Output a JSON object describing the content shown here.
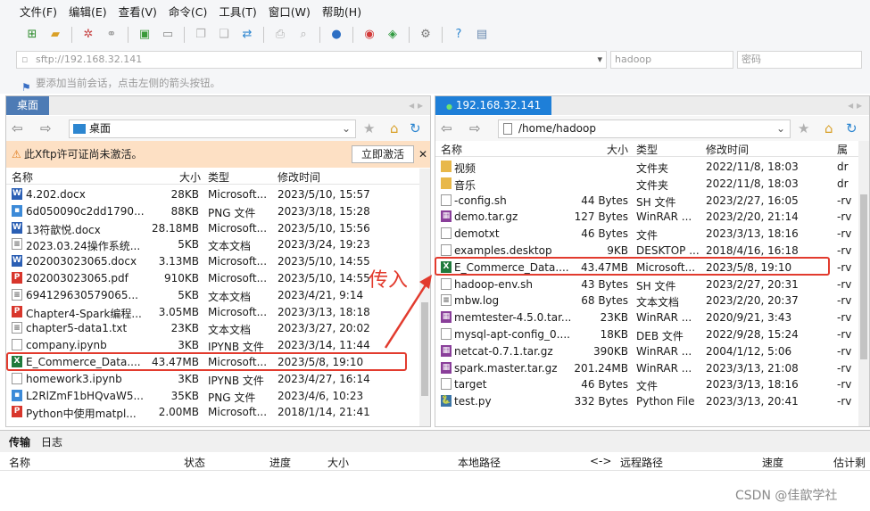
{
  "menu": [
    "文件(F)",
    "编辑(E)",
    "查看(V)",
    "命令(C)",
    "工具(T)",
    "窗口(W)",
    "帮助(H)"
  ],
  "address": {
    "host": "sftp://192.168.32.141",
    "user_placeholder": "hadoop",
    "password_placeholder": "密码"
  },
  "hint": "要添加当前会话，点击左侧的箭头按钮。",
  "left_panel": {
    "tab": "桌面",
    "path": "桌面",
    "warning": "此Xftp许可证尚未激活。",
    "activate_label": "立即激活",
    "columns": [
      "名称",
      "大小",
      "类型",
      "修改时间"
    ],
    "rows": [
      {
        "name": "4.202.docx",
        "size": "28KB",
        "type": "Microsoft...",
        "date": "2023/5/10, 15:57",
        "icon": "word"
      },
      {
        "name": "6d050090c2dd1790...",
        "size": "88KB",
        "type": "PNG 文件",
        "date": "2023/3/18, 15:28",
        "icon": "png"
      },
      {
        "name": "13符歆悦.docx",
        "size": "28.18MB",
        "type": "Microsoft...",
        "date": "2023/5/10, 15:56",
        "icon": "word"
      },
      {
        "name": "2023.03.24操作系统...",
        "size": "5KB",
        "type": "文本文档",
        "date": "2023/3/24, 19:23",
        "icon": "txt"
      },
      {
        "name": "202003023065.docx",
        "size": "3.13MB",
        "type": "Microsoft...",
        "date": "2023/5/10, 14:55",
        "icon": "word"
      },
      {
        "name": "202003023065.pdf",
        "size": "910KB",
        "type": "Microsoft...",
        "date": "2023/5/10, 14:55",
        "icon": "pdf"
      },
      {
        "name": "694129630579065...",
        "size": "5KB",
        "type": "文本文档",
        "date": "2023/4/21, 9:14",
        "icon": "txt"
      },
      {
        "name": "Chapter4-Spark编程...",
        "size": "3.05MB",
        "type": "Microsoft...",
        "date": "2023/3/13, 18:18",
        "icon": "pdf"
      },
      {
        "name": "chapter5-data1.txt",
        "size": "23KB",
        "type": "文本文档",
        "date": "2023/3/27, 20:02",
        "icon": "txt"
      },
      {
        "name": "company.ipynb",
        "size": "3KB",
        "type": "IPYNB 文件",
        "date": "2023/3/14, 11:44",
        "icon": "file"
      },
      {
        "name": "E_Commerce_Data....",
        "size": "43.47MB",
        "type": "Microsoft...",
        "date": "2023/5/8, 19:10",
        "icon": "excel"
      },
      {
        "name": "homework3.ipynb",
        "size": "3KB",
        "type": "IPYNB 文件",
        "date": "2023/4/27, 16:14",
        "icon": "file"
      },
      {
        "name": "L2RlZmF1bHQvaW5...",
        "size": "35KB",
        "type": "PNG 文件",
        "date": "2023/4/6, 10:23",
        "icon": "png"
      },
      {
        "name": "Python中使用matpl...",
        "size": "2.00MB",
        "type": "Microsoft...",
        "date": "2018/1/14, 21:41",
        "icon": "pdf"
      }
    ]
  },
  "right_panel": {
    "tab": "192.168.32.141",
    "path": "/home/hadoop",
    "columns": [
      "名称",
      "大小",
      "类型",
      "修改时间",
      "属"
    ],
    "rows": [
      {
        "name": "视频",
        "size": "",
        "type": "文件夹",
        "date": "2022/11/8, 18:03",
        "perm": "dr",
        "icon": "folder"
      },
      {
        "name": "音乐",
        "size": "",
        "type": "文件夹",
        "date": "2022/11/8, 18:03",
        "perm": "dr",
        "icon": "folder"
      },
      {
        "name": "-config.sh",
        "size": "44 Bytes",
        "type": "SH 文件",
        "date": "2023/2/27, 16:05",
        "perm": "-rv",
        "icon": "file"
      },
      {
        "name": "demo.tar.gz",
        "size": "127 Bytes",
        "type": "WinRAR ...",
        "date": "2023/2/20, 21:14",
        "perm": "-rv",
        "icon": "rar"
      },
      {
        "name": "demotxt",
        "size": "46 Bytes",
        "type": "文件",
        "date": "2023/3/13, 18:16",
        "perm": "-rv",
        "icon": "file"
      },
      {
        "name": "examples.desktop",
        "size": "9KB",
        "type": "DESKTOP ...",
        "date": "2018/4/16, 16:18",
        "perm": "-rv",
        "icon": "file"
      },
      {
        "name": "E_Commerce_Data....",
        "size": "43.47MB",
        "type": "Microsoft...",
        "date": "2023/5/8, 19:10",
        "perm": "-rv",
        "icon": "excel"
      },
      {
        "name": "hadoop-env.sh",
        "size": "43 Bytes",
        "type": "SH 文件",
        "date": "2023/2/27, 20:31",
        "perm": "-rv",
        "icon": "file"
      },
      {
        "name": "mbw.log",
        "size": "68 Bytes",
        "type": "文本文档",
        "date": "2023/2/20, 20:37",
        "perm": "-rv",
        "icon": "txt"
      },
      {
        "name": "memtester-4.5.0.tar...",
        "size": "23KB",
        "type": "WinRAR ...",
        "date": "2020/9/21, 3:43",
        "perm": "-rv",
        "icon": "rar"
      },
      {
        "name": "mysql-apt-config_0....",
        "size": "18KB",
        "type": "DEB 文件",
        "date": "2022/9/28, 15:24",
        "perm": "-rv",
        "icon": "file"
      },
      {
        "name": "netcat-0.7.1.tar.gz",
        "size": "390KB",
        "type": "WinRAR ...",
        "date": "2004/1/12, 5:06",
        "perm": "-rv",
        "icon": "rar"
      },
      {
        "name": "spark.master.tar.gz",
        "size": "201.24MB",
        "type": "WinRAR ...",
        "date": "2023/3/13, 21:08",
        "perm": "-rv",
        "icon": "rar"
      },
      {
        "name": "target",
        "size": "46 Bytes",
        "type": "文件",
        "date": "2023/3/13, 18:16",
        "perm": "-rv",
        "icon": "file"
      },
      {
        "name": "test.py",
        "size": "332 Bytes",
        "type": "Python File",
        "date": "2023/3/13, 20:41",
        "perm": "-rv",
        "icon": "py"
      }
    ]
  },
  "annotation": "传入",
  "bottom": {
    "tabs": [
      "传输",
      "日志"
    ],
    "columns": [
      "名称",
      "状态",
      "进度",
      "大小",
      "本地路径",
      "<->",
      "远程路径",
      "速度",
      "估计剩"
    ]
  },
  "watermark": "CSDN @佳歆学社",
  "colors": {
    "accent": "#1e7fd8",
    "tab_left": "#4d7bb5",
    "warning_bg": "#fde0c4",
    "highlight": "#e23b2e"
  }
}
